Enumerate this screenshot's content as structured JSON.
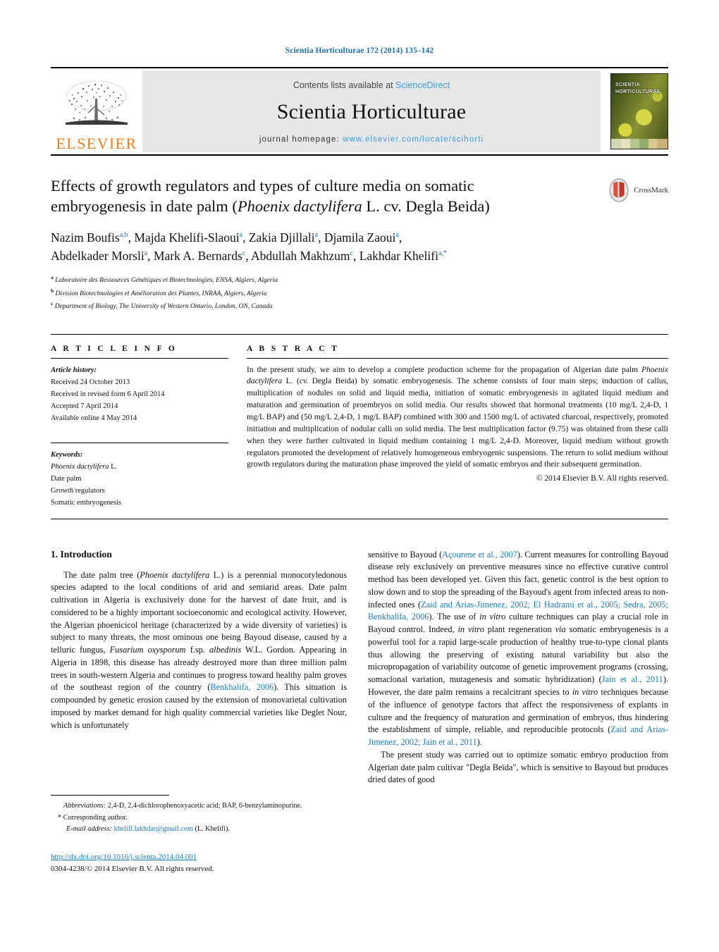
{
  "running_head": "Scientia Horticulturae 172 (2014) 135–142",
  "masthead": {
    "publisher_wordmark": "ELSEVIER",
    "contents_prefix": "Contents lists available at",
    "contents_link": "ScienceDirect",
    "journal_title": "Scientia Horticulturae",
    "homepage_prefix": "journal homepage:",
    "homepage_url": "www.elsevier.com/locate/scihorti",
    "cover_title_line1": "SCIENTIA",
    "cover_title_line2": "HORTICULTURAE"
  },
  "article": {
    "title_line1": "Effects of growth regulators and types of culture media on somatic",
    "title_line2_a": "embryogenesis in date palm (",
    "title_italic": "Phoenix dactylifera",
    "title_line2_b": " L. cv. Degla Beida)",
    "crossmark_label": "CrossMark",
    "authors_line1": "Nazim Boufis",
    "authors": [
      {
        "name": "Nazim Boufis",
        "sup": "a,b"
      },
      {
        "name": "Majda Khelifi-Slaoui",
        "sup": "a"
      },
      {
        "name": "Zakia Djillali",
        "sup": "a"
      },
      {
        "name": "Djamila Zaoui",
        "sup": "a"
      },
      {
        "name": "Abdelkader Morsli",
        "sup": "a"
      },
      {
        "name": "Mark A. Bernards",
        "sup": "c"
      },
      {
        "name": "Abdullah Makhzum",
        "sup": "c"
      },
      {
        "name": "Lakhdar Khelifi",
        "sup": "a,*"
      }
    ],
    "affiliations": [
      {
        "marker": "a",
        "text": "Laboratoire des Ressources Génétiques et Biotechnologies, ENSA, Algiers, Algeria"
      },
      {
        "marker": "b",
        "text": "Division Biotechnologies et Amélioration des Plantes, INRAA, Algiers, Algeria"
      },
      {
        "marker": "c",
        "text": "Department of Biology, The University of Western Ontario, London, ON, Canada"
      }
    ]
  },
  "article_info": {
    "label": "A R T I C L E  I N F O",
    "history_head": "Article history:",
    "history": [
      "Received 24 October 2013",
      "Received in revised form 6 April 2014",
      "Accepted 7 April 2014",
      "Available online 4 May 2014"
    ],
    "keywords_head": "Keywords:",
    "keywords_italic_first": "Phoenix dactylifera",
    "keywords_first_tail": " L.",
    "keywords": [
      "Date palm",
      "Growth regulators",
      "Somatic embryogenesis"
    ]
  },
  "abstract": {
    "label": "A B S T R A C T",
    "p1_a": "In the present study, we aim to develop a complete production scheme for the propagation of Algerian date palm ",
    "p1_italic1": "Phoenix dactylifera",
    "p1_b": " L. (",
    "p1_italic2": "cv.",
    "p1_c": " Degla Beida) by somatic embryogenesis. The scheme consists of four main steps; induction of callus, multiplication of nodules on solid and liquid media, initiation of somatic embryogenesis in agitated liquid medium and maturation and germination of proembryos on solid media. Our results showed that hormonal treatments (10 mg/L 2,4-D, 1 mg/L BAP) and (50 mg/L 2,4-D, 1 mg/L BAP) combined with 300 and 1500 mg/L of activated charcoal, respectively, promoted initiation and multiplication of nodular calli on solid media. The best multiplication factor (9.75) was obtained from these calli when they were further cultivated in liquid medium containing 1 mg/L 2,4-D. Moreover, liquid medium without growth regulators promoted the development of relatively homogeneous embryogenic suspensions. The return to solid medium without growth regulators during the maturation phase improved the yield of somatic embryos and their subsequent germination.",
    "copyright": "© 2014 Elsevier B.V. All rights reserved."
  },
  "introduction": {
    "heading": "1.  Introduction",
    "left_p1_a": "The date palm tree (",
    "left_p1_italic": "Phoenix dactylifera",
    "left_p1_b": " L.) is a perennial monocotyledonous species adapted to the local conditions of arid and semiarid areas. Date palm cultivation in Algeria is exclusively done for the harvest of date fruit, and is considered to be a highly important socioeconomic and ecological activity. However, the Algerian phoenicicol heritage (characterized by a wide diversity of varieties) is subject to many threats, the most ominous one being Bayoud disease, caused by a telluric fungus, ",
    "left_p1_italic2": "Fusarium oxysporum",
    "left_p1_c": " f.sp. ",
    "left_p1_italic3": "albedinis",
    "left_p1_d": " W.L. Gordon. Appearing in Algeria in 1898, this disease has already destroyed more than three million palm trees in south-western Algeria and continues to progress toward healthy palm groves of the southeast region of the country (",
    "left_ref1": "Benkhalifa, 2006",
    "left_p1_e": "). This situation is compounded by genetic erosion caused by the extension of monovarietal cultivation imposed by market demand for high quality commercial varieties like Deglet Nour, which is unfortunately",
    "right_p1_a": "sensitive to Bayoud (",
    "right_ref1": "Açourene et al., 2007",
    "right_p1_b": "). Current measures for controlling Bayoud disease rely exclusively on preventive measures since no effective curative control method has been developed yet. Given this fact, genetic control is the best option to slow down and to stop the spreading of the Bayoud's agent from infected areas to non-infected ones (",
    "right_ref2": "Zaid and Arias-Jimenez, 2002; El Hadrami et al., 2005; Sedra, 2005; Benkhalifa, 2006",
    "right_p1_c": "). The use of ",
    "right_p1_italic1": "in vitro",
    "right_p1_d": " culture techniques can play a crucial role in Bayoud control. Indeed, ",
    "right_p1_italic2": "in vitro",
    "right_p1_e": " plant regeneration ",
    "right_p1_italic3": "via",
    "right_p1_f": " somatic embryogenesis is a powerful tool for a rapid large-scale production of healthy true-to-type clonal plants thus allowing the preserving of existing natural variability but also the micropropagation of variability outcome of genetic improvement programs (crossing, somaclonal variation, mutagenesis and somatic hybridization) (",
    "right_ref3": "Jain et al., 2011",
    "right_p1_g": "). However, the date palm remains a recalcitrant species to ",
    "right_p1_italic4": "in vitro",
    "right_p1_h": " techniques because of the influence of genotype factors that affect the responsiveness of explants in culture and the frequency of maturation and germination of embryos, thus hindering the establishment of simple, reliable, and reproducible protocols (",
    "right_ref4": "Zaid and Arias-Jimenez, 2002; Jain et al., 2011",
    "right_p1_i": ").",
    "right_p2": "The present study was carried out to optimize somatic embryo production from Algerian date palm cultivar \"Degla Beïda\", which is sensitive to Bayoud but produces dried dates of good"
  },
  "footnotes": {
    "abbrev_head": "Abbreviations:",
    "abbrev_text": " 2,4-D, 2,4-dichlorophenoxyacetic acid; BAP, 6-benzylaminopurine.",
    "corresponding": "*  Corresponding author.",
    "email_label": "E-mail address:",
    "email": "khelifi.lakhdar@gmail.com",
    "email_tail": " (L. Khelifi).",
    "doi": "http://dx.doi.org/10.1016/j.scienta.2014.04.001",
    "issn": "0304-4238/© 2014 Elsevier B.V. All rights reserved."
  },
  "colors": {
    "link_blue": "#1a7bb0",
    "header_blue": "#1a6ea8",
    "sciencedirect_blue": "#3c9bd4",
    "elsevier_orange": "#ef7d1a",
    "masthead_gray": "#e6e7e8"
  }
}
